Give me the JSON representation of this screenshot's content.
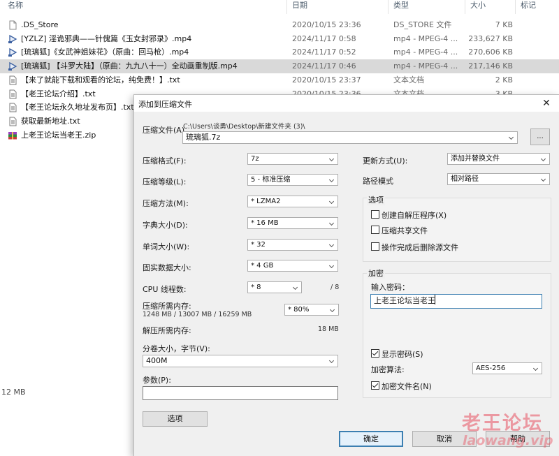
{
  "explorer": {
    "columns": {
      "name": "名称",
      "date": "日期",
      "type": "类型",
      "size": "大小",
      "tags": "标记"
    },
    "files": [
      {
        "name": ".DS_Store",
        "date": "2020/10/15 23:36",
        "type": "DS_STORE 文件",
        "size": "7 KB",
        "icon": "blank-file-icon",
        "selected": false
      },
      {
        "name": "[YZLZ] 淫诡邪典——针傀篇《玉女封邪录》.mp4",
        "date": "2024/11/17 0:58",
        "type": "mp4 - MPEG-4 ...",
        "size": "233,627 KB",
        "icon": "video-file-icon",
        "selected": false
      },
      {
        "name": "[琉璃狐]《女武神姐妹花》（原曲：回马枪）.mp4",
        "date": "2024/11/17 0:52",
        "type": "mp4 - MPEG-4 ...",
        "size": "270,606 KB",
        "icon": "video-file-icon",
        "selected": false
      },
      {
        "name": "[琉璃狐] 【斗罗大陆】（原曲：九九八十一）全动画重制版.mp4",
        "date": "2024/11/17 0:46",
        "type": "mp4 - MPEG-4 ...",
        "size": "217,146 KB",
        "icon": "video-file-icon",
        "selected": true
      },
      {
        "name": "【来了就能下载和观看的论坛，纯免费！】.txt",
        "date": "2020/10/15 23:37",
        "type": "文本文档",
        "size": "2 KB",
        "icon": "text-file-icon",
        "selected": false
      },
      {
        "name": "【老王论坛介绍】.txt",
        "date": "2020/10/15 23:36",
        "type": "文本文档",
        "size": "3 KB",
        "icon": "text-file-icon",
        "selected": false
      },
      {
        "name": "【老王论坛永久地址发布页】.txt",
        "date": "",
        "type": "",
        "size": "",
        "icon": "text-file-icon",
        "selected": false
      },
      {
        "name": "获取最新地址.txt",
        "date": "",
        "type": "",
        "size": "",
        "icon": "text-file-icon",
        "selected": false
      },
      {
        "name": "上老王论坛当老王.zip",
        "date": "",
        "type": "",
        "size": "",
        "icon": "zip-archive-icon",
        "selected": false
      }
    ],
    "status_size": "12 MB"
  },
  "dialog": {
    "title": "添加到压缩文件",
    "archive_label": "压缩文件(A)",
    "archive_path": "C:\\Users\\谈勇\\Desktop\\新建文件夹 (3)\\",
    "archive_name": "琉璃狐.7z",
    "browse_label": "...",
    "left": {
      "format_label": "压缩格式(F):",
      "format_value": "7z",
      "level_label": "压缩等级(L):",
      "level_value": "5 - 标准压缩",
      "method_label": "压缩方法(M):",
      "method_value": "* LZMA2",
      "dict_label": "字典大小(D):",
      "dict_value": "* 16 MB",
      "word_label": "单词大小(W):",
      "word_value": "* 32",
      "solid_label": "固实数据大小:",
      "solid_value": "* 4 GB",
      "cpu_label": "CPU 线程数:",
      "cpu_value": "* 8",
      "cpu_max": "/ 8",
      "mem_label": "压缩所需内存:",
      "mem_detail": "1248 MB / 13007 MB / 16259 MB",
      "mem_value": "* 80%",
      "decomp_label": "解压所需内存:",
      "decomp_value": "18 MB",
      "volume_label": "分卷大小，字节(V):",
      "volume_value": "400M",
      "params_label": "参数(P):",
      "params_value": "",
      "options_button": "选项"
    },
    "right": {
      "update_label": "更新方式(U):",
      "update_value": "添加并替换文件",
      "path_label": "路径模式",
      "path_value": "相对路径",
      "options_title": "选项",
      "opt_sfx": "创建自解压程序(X)",
      "opt_shared": "压缩共享文件",
      "opt_delete": "操作完成后删除源文件",
      "encryption_title": "加密",
      "password_label": "输入密码：",
      "password_value": "上老王论坛当老王",
      "show_password": "显示密码(S)",
      "enc_method_label": "加密算法:",
      "enc_method_value": "AES-256",
      "encrypt_names": "加密文件名(N)"
    },
    "buttons": {
      "ok": "确定",
      "cancel": "取消",
      "help": "帮助"
    }
  },
  "watermark": {
    "text": "老王论坛",
    "url": "laowang.vip"
  }
}
